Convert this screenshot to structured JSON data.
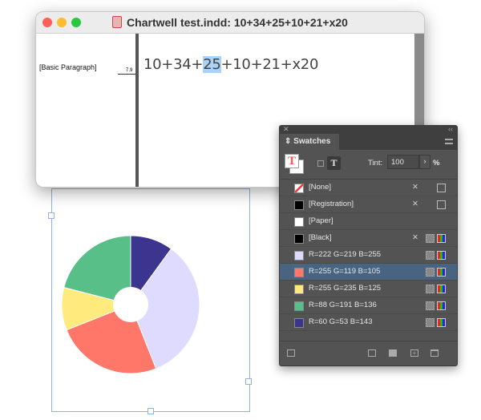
{
  "window": {
    "title": "Chartwell test.indd: 10+34+25+10+21+x20",
    "paragraph_style": "[Basic Paragraph]",
    "ruler_value": "7.9",
    "story": {
      "before": "10+34+",
      "highlight": "25",
      "after": "+10+21+x20"
    }
  },
  "panel": {
    "title": "Swatches",
    "tint_label": "Tint:",
    "tint_value": "100",
    "tint_unit": "%",
    "swatches": [
      {
        "name": "[None]",
        "color": "none",
        "selected": false
      },
      {
        "name": "[Registration]",
        "color": "#000000",
        "selected": false
      },
      {
        "name": "[Paper]",
        "color": "#ffffff",
        "selected": false
      },
      {
        "name": "[Black]",
        "color": "#000000",
        "selected": false
      },
      {
        "name": "R=222 G=219 B=255",
        "color": "#dedbff",
        "selected": false
      },
      {
        "name": "R=255 G=119 B=105",
        "color": "#ff7769",
        "selected": true
      },
      {
        "name": "R=255 G=235 B=125",
        "color": "#ffeb7d",
        "selected": false
      },
      {
        "name": "R=88 G=191 B=136",
        "color": "#58bf88",
        "selected": false
      },
      {
        "name": "R=60 G=53 B=143",
        "color": "#3c358f",
        "selected": false
      }
    ]
  },
  "chart_data": {
    "type": "pie",
    "donut": true,
    "values": [
      10,
      34,
      25,
      10,
      21
    ],
    "colors": [
      "#3c358f",
      "#dedbff",
      "#ff7769",
      "#ffeb7d",
      "#58bf88"
    ],
    "hole": 20
  }
}
